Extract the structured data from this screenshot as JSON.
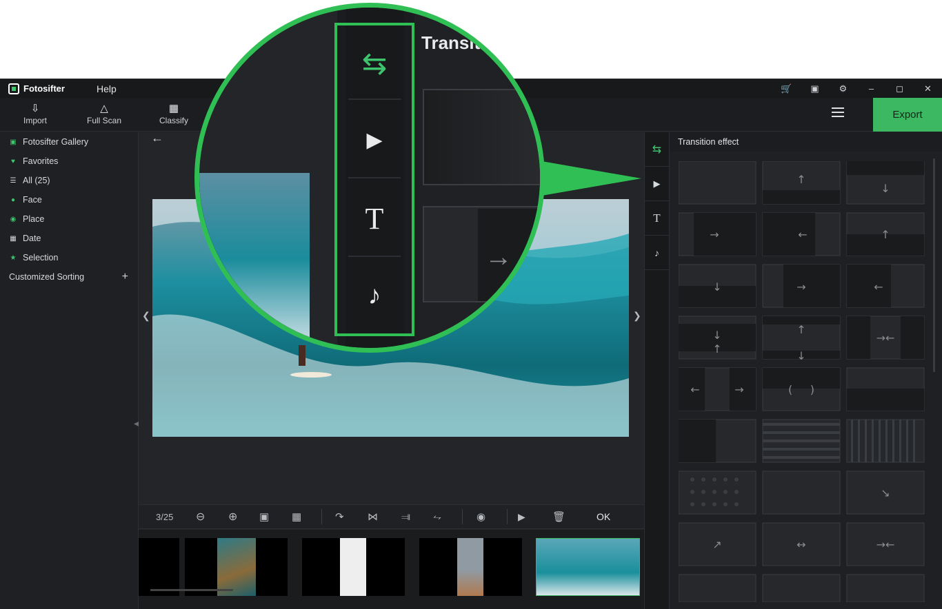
{
  "app": {
    "name": "Fotosifter",
    "menu_help": "Help"
  },
  "toolbar": {
    "import": "Import",
    "full_scan": "Full Scan",
    "classify": "Classify",
    "export": "Export"
  },
  "sidebar": {
    "items": [
      {
        "label": "Fotosifter Gallery",
        "icon": "gallery-icon"
      },
      {
        "label": "Favorites",
        "icon": "favorites-icon"
      },
      {
        "label": "All (25)",
        "icon": "list-icon"
      },
      {
        "label": "Face",
        "icon": "face-icon"
      },
      {
        "label": "Place",
        "icon": "place-icon"
      },
      {
        "label": "Date",
        "icon": "calendar-icon"
      },
      {
        "label": "Selection",
        "icon": "selection-icon"
      }
    ],
    "custom_sorting": "Customized Sorting"
  },
  "viewer": {
    "counter": "3/25",
    "ok": "OK"
  },
  "panel": {
    "title": "Transition effect"
  },
  "magnifier": {
    "title": "Transiti"
  },
  "colors": {
    "accent": "#3cb762",
    "background": "#1e2023"
  }
}
